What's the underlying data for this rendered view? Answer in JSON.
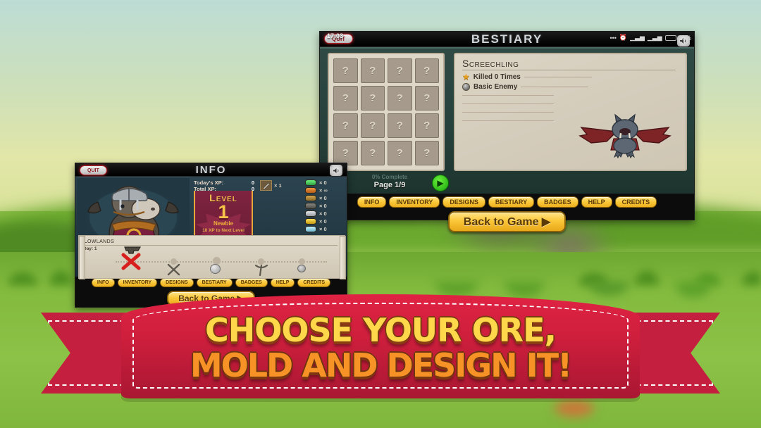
{
  "background": {
    "sky_color": "#cfe0b8",
    "grass_color": "#8cc247"
  },
  "bestiary_window": {
    "title": "BESTIARY",
    "quit_label": "QUIT",
    "clock": "17:03",
    "sound_icon": "speaker-icon",
    "status_icons": [
      "more-dots-icon",
      "alarm-icon",
      "signal-icon",
      "signal-icon",
      "battery-icon"
    ],
    "battery_label": "11%",
    "grid_cards": [
      "?",
      "?",
      "?",
      "?",
      "?",
      "?",
      "?",
      "?",
      "?",
      "?",
      "?",
      "?",
      "?",
      "?",
      "?",
      "?"
    ],
    "progress_label": "0% Complete",
    "page_label": "Page 1/9",
    "prev_icon": "chevron-left-icon",
    "next_icon": "play-arrow-icon",
    "entry": {
      "name": "Screechling",
      "stats": [
        {
          "icon": "star-icon",
          "text": "Killed 0 Times"
        },
        {
          "icon": "orb-icon",
          "text": "Basic Enemy"
        }
      ],
      "creature_icon": "bat-creature-icon"
    },
    "nav": [
      "INFO",
      "INVENTORY",
      "DESIGNS",
      "BESTIARY",
      "BADGES",
      "HELP",
      "CREDITS"
    ],
    "back_label": "Back to Game ▶"
  },
  "info_window": {
    "title": "INFO",
    "quit_label": "QUIT",
    "sound_icon": "speaker-icon",
    "portrait_icon": "goat-viking-avatar",
    "xp": [
      {
        "label": "Today's XP:",
        "value": "0"
      },
      {
        "label": "Total XP:",
        "value": "0"
      }
    ],
    "level": {
      "word": "Level",
      "number": "1",
      "rank": "Newbie",
      "next": "10 XP to Next Level"
    },
    "weapon": {
      "icon": "sword-icon",
      "qty": "× 1"
    },
    "resources": [
      {
        "icon": "gem-green-icon",
        "color": "#3ec45a",
        "qty": "× 0"
      },
      {
        "icon": "copper-ore-icon",
        "color": "#d97a2b",
        "qty": "× ∞"
      },
      {
        "icon": "bronze-ore-icon",
        "color": "#b08a3e",
        "qty": "× 0"
      },
      {
        "icon": "dark-ore-icon",
        "color": "#6b6a66",
        "qty": "× 0"
      },
      {
        "icon": "silver-ore-icon",
        "color": "#b9bec4",
        "qty": "× 0"
      },
      {
        "icon": "gold-ore-icon",
        "color": "#e3bc2d",
        "qty": "× 0"
      },
      {
        "icon": "crystal-blue-icon",
        "color": "#8fd3e6",
        "qty": "× 0"
      }
    ],
    "map": {
      "region": "Lowlands",
      "day_label": "Day: 1",
      "marker_icon": "red-x-swords-icon",
      "anvil_icon": "anvil-icon",
      "node_icons": [
        "crossed-axes-icon",
        "rock-icon",
        "pickaxe-icon",
        "coin-icon"
      ]
    },
    "nav": [
      "INFO",
      "INVENTORY",
      "DESIGNS",
      "BESTIARY",
      "BADGES",
      "HELP",
      "CREDITS"
    ],
    "back_label": "Back to Game ▶"
  },
  "banner": {
    "line1": "CHOOSE YOUR ORE,",
    "line2": "MOLD AND DESIGN IT!",
    "ribbon_color": "#cf1f3d",
    "line1_color": "#ffd74a",
    "line2_color": "#f79226"
  }
}
